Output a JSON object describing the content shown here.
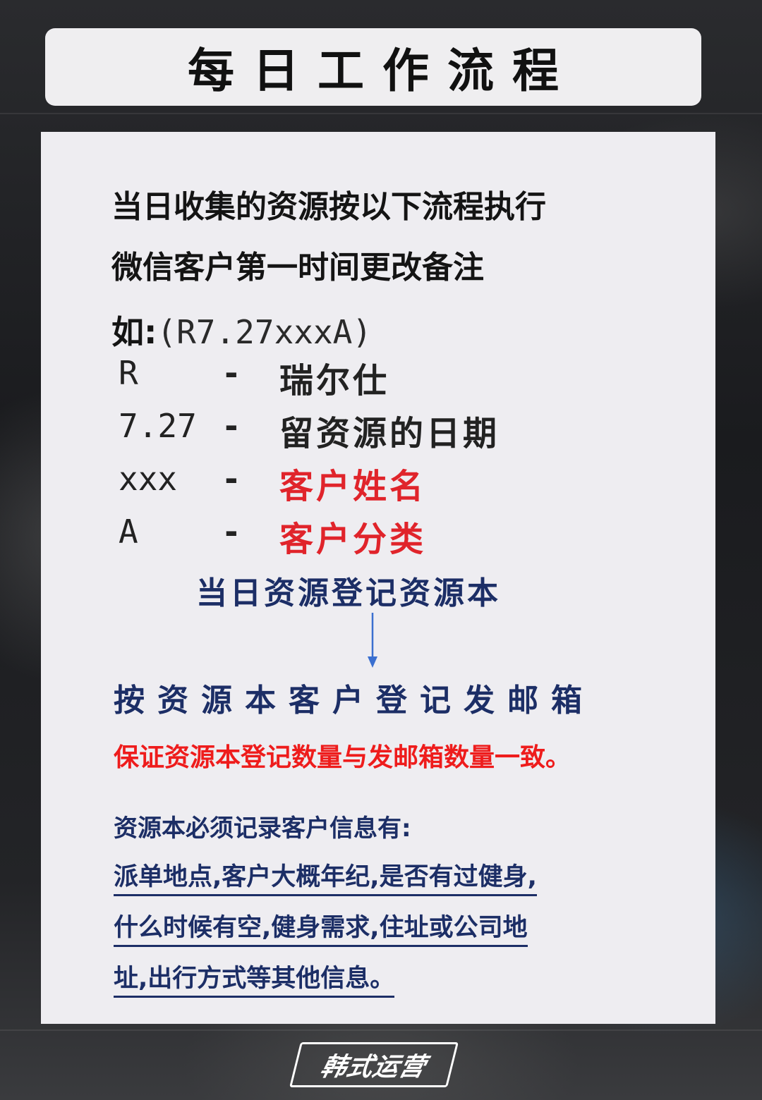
{
  "title": "每日工作流程",
  "intro": {
    "line1": "当日收集的资源按以下流程执行",
    "line2": "微信客户第一时间更改备注"
  },
  "example": {
    "prefix": "如:",
    "code": "(R7.27xxxA)"
  },
  "legend": [
    {
      "key": "R",
      "dash": "-",
      "value": "瑞尔仕",
      "highlight": false
    },
    {
      "key": "7.27",
      "dash": "-",
      "value": "留资源的日期",
      "highlight": false
    },
    {
      "key": "xxx",
      "dash": "-",
      "value": "客户姓名",
      "highlight": true
    },
    {
      "key": "A",
      "dash": "-",
      "value": "客户分类",
      "highlight": true
    }
  ],
  "flow": {
    "step1": "当日资源登记资源本",
    "step2": "按资源本客户登记发邮箱",
    "note": "保证资源本登记数量与发邮箱数量一致。"
  },
  "info": {
    "heading": "资源本必须记录客户信息有:",
    "lines": [
      "派单地点,客户大概年纪,是否有过健身,",
      "什么时候有空,健身需求,住址或公司地",
      "址,出行方式等其他信息。"
    ]
  },
  "logo_text": "韩式运营",
  "colors": {
    "dark_blue": "#1c2e66",
    "red": "#e0242b",
    "card_bg": "#eeedf1"
  }
}
